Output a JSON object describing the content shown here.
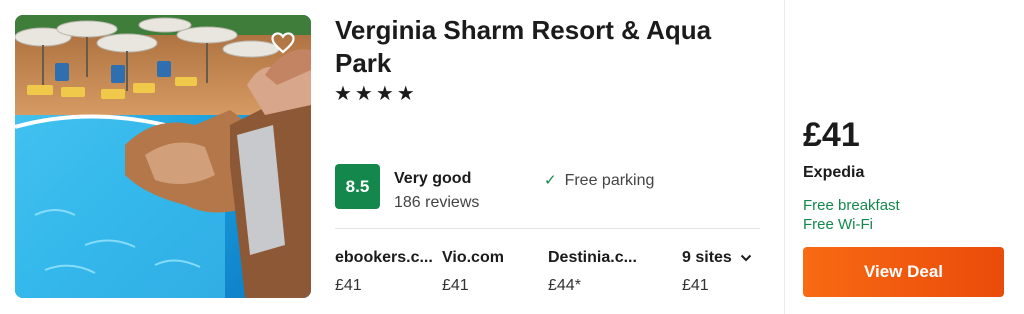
{
  "hotel": {
    "name": "Verginia Sharm Resort & Aqua Park",
    "stars": "★★★★",
    "star_count": 4
  },
  "rating": {
    "score": "8.5",
    "label": "Very good",
    "reviews": "186 reviews",
    "color": "#14884c"
  },
  "amenity": {
    "icon": "check-icon",
    "label": "Free parking"
  },
  "other_sites": [
    {
      "name": "ebookers.c...",
      "price": "£41"
    },
    {
      "name": "Vio.com",
      "price": "£41"
    },
    {
      "name": "Destinia.c...",
      "price": "£44*"
    }
  ],
  "more_sites": {
    "label": "9 sites",
    "price": "£41",
    "icon": "chevron-down-icon"
  },
  "best_offer": {
    "price": "£41",
    "provider": "Expedia",
    "perks": [
      "Free breakfast",
      "Free Wi-Fi"
    ],
    "button_label": "View Deal",
    "button_color": "#f7580f"
  },
  "favorite": {
    "icon": "heart-icon"
  }
}
